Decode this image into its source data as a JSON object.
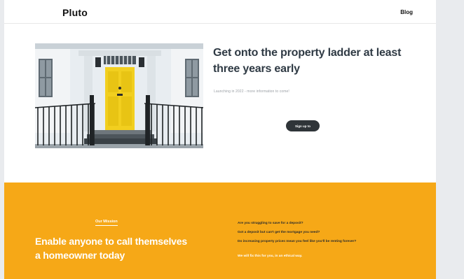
{
  "header": {
    "logo": "Pluto",
    "nav": {
      "blog": "Blog"
    }
  },
  "hero": {
    "title": "Get onto the property ladder at least three years early",
    "subtitle": "Launching in 2022 - more information to come!",
    "cta_label": "Sign up to waitlist",
    "image_alt": "Yellow front door of a white townhouse"
  },
  "mission": {
    "label": "Our Mission",
    "heading": "Enable anyone to call themselves a homeowner today",
    "questions": [
      "Are you struggling to save for a deposit?",
      "Got a deposit but can't get the mortgage you need?",
      "Do increasing property prices mean you feel like you'll be renting forever?"
    ],
    "tagline": "We will fix this for you, in an ethical way."
  },
  "colors": {
    "accent": "#f6a817",
    "button": "#2f3438",
    "door": "#f2cf1f"
  }
}
